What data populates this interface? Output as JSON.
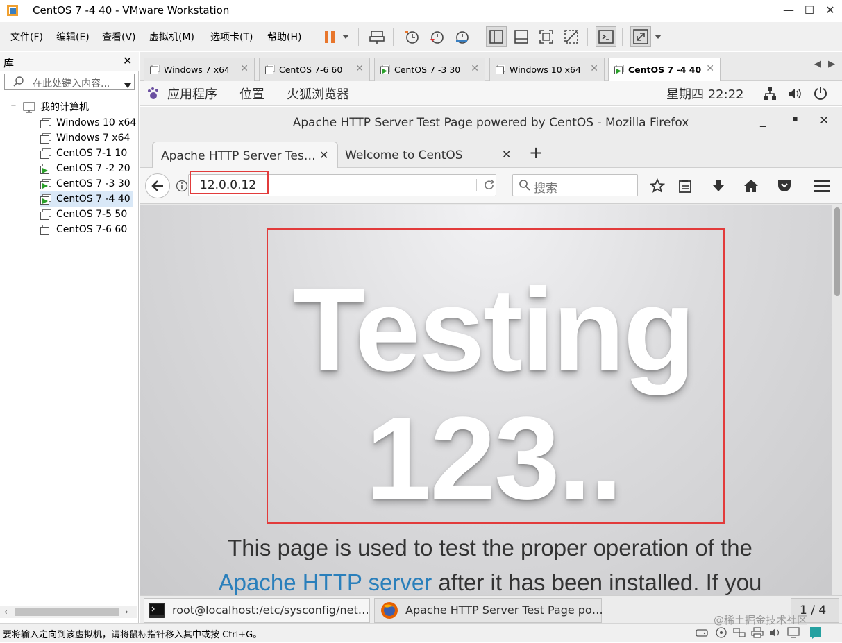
{
  "window": {
    "title": "CentOS 7 -4 40 - VMware Workstation"
  },
  "menu": [
    "文件(F)",
    "编辑(E)",
    "查看(V)",
    "虚拟机(M)",
    "选项卡(T)",
    "帮助(H)"
  ],
  "library": {
    "title": "库",
    "search_placeholder": "在此处键入内容...",
    "root": "我的计算机",
    "items": [
      {
        "label": "Windows 10 x64",
        "running": false
      },
      {
        "label": "Windows 7 x64",
        "running": false
      },
      {
        "label": "CentOS 7-1  10",
        "running": false
      },
      {
        "label": "CentOS 7 -2 20",
        "running": true
      },
      {
        "label": "CentOS 7 -3 30",
        "running": true
      },
      {
        "label": "CentOS 7 -4 40",
        "running": true
      },
      {
        "label": "CentOS 7-5 50",
        "running": false
      },
      {
        "label": "CentOS 7-6  60",
        "running": false
      }
    ]
  },
  "vm_tabs": [
    {
      "label": "Windows 7 x64",
      "active": false,
      "running": false
    },
    {
      "label": "CentOS 7-6  60",
      "active": false,
      "running": false
    },
    {
      "label": "CentOS 7 -3 30",
      "active": false,
      "running": true
    },
    {
      "label": "Windows 10 x64",
      "active": false,
      "running": false
    },
    {
      "label": "CentOS 7 -4 40",
      "active": true,
      "running": true
    }
  ],
  "gnome": {
    "apps": "应用程序",
    "places": "位置",
    "browser": "火狐浏览器",
    "clock": "星期四 22:22"
  },
  "firefox": {
    "title": "Apache HTTP Server Test Page powered by CentOS - Mozilla Firefox",
    "tabs": [
      "Apache HTTP Server Tes…",
      "Welcome to CentOS"
    ],
    "url": "12.0.0.12",
    "search_placeholder": "搜索",
    "page": {
      "big_line1": "Testing",
      "big_line2": "123..",
      "desc_line1": "This page is used to test the proper operation of the",
      "desc_link": "Apache HTTP server",
      "desc_line2_rest": " after it has been installed. If you"
    }
  },
  "taskbar": {
    "terminal": "root@localhost:/etc/sysconfig/net…",
    "firefox": "Apache HTTP Server Test Page po…",
    "workspace": "1 / 4"
  },
  "statusbar": {
    "message": "要将输入定向到该虚拟机，请将鼠标指针移入其中或按 Ctrl+G。",
    "watermark": "@稀土掘金技术社区"
  },
  "colors": {
    "highlight": "#e23b3b",
    "link": "#2a7fbb",
    "pause": "#e8762c",
    "running": "#2aa02a"
  }
}
